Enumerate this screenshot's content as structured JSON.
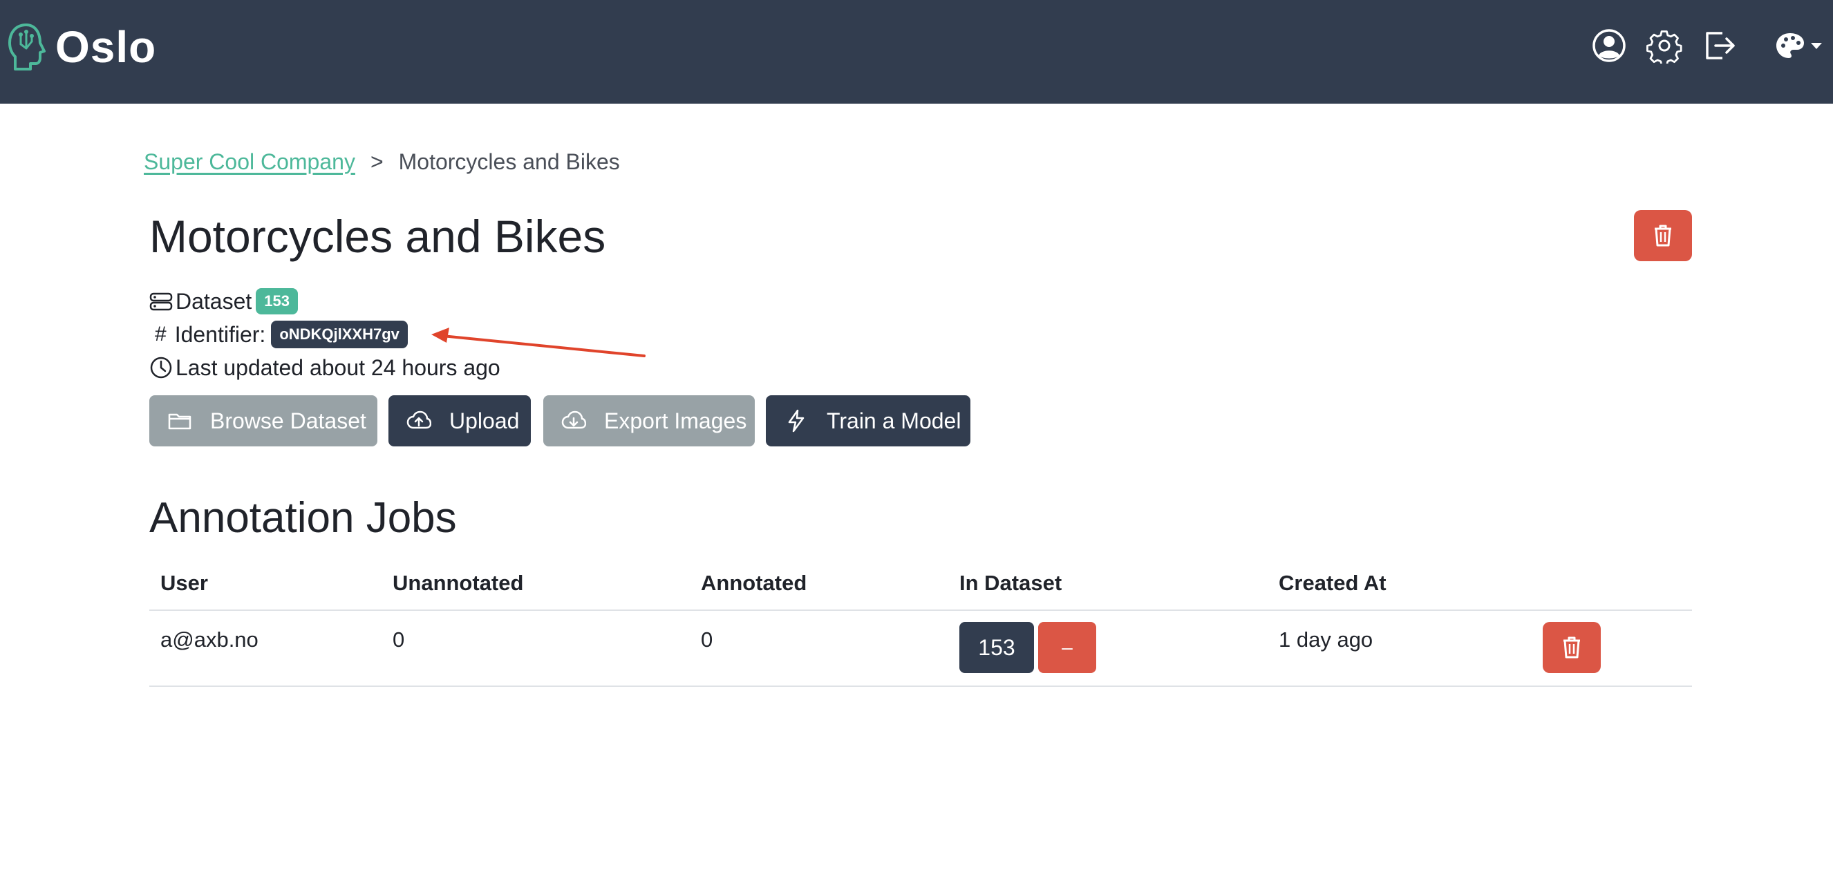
{
  "app": {
    "name": "Oslo"
  },
  "nav": {
    "icons": [
      "user-circle-icon",
      "gear-icon",
      "logout-icon",
      "palette-icon"
    ]
  },
  "breadcrumb": {
    "parent": "Super Cool Company",
    "separator": ">",
    "current": "Motorcycles and Bikes"
  },
  "page": {
    "title": "Motorcycles and Bikes"
  },
  "meta": {
    "dataset_label": "Dataset",
    "dataset_count": "153",
    "identifier_prefix": "#",
    "identifier_label": "Identifier:",
    "identifier_value": "oNDKQjlXXH7gv",
    "updated": "Last updated about 24 hours ago"
  },
  "actions": {
    "browse": "Browse Dataset",
    "upload": "Upload",
    "export": "Export Images",
    "train": "Train a Model"
  },
  "jobs": {
    "title": "Annotation Jobs",
    "columns": [
      "User",
      "Unannotated",
      "Annotated",
      "In Dataset",
      "Created At"
    ],
    "rows": [
      {
        "user": "a@axb.no",
        "unannotated": "0",
        "annotated": "0",
        "in_dataset": "153",
        "minus": "–",
        "created": "1 day ago"
      }
    ]
  },
  "colors": {
    "navbar": "#323d4f",
    "accent_green": "#4db89a",
    "danger": "#db5645",
    "muted_button": "#98a2a6",
    "annotation_arrow": "#e0442b"
  }
}
